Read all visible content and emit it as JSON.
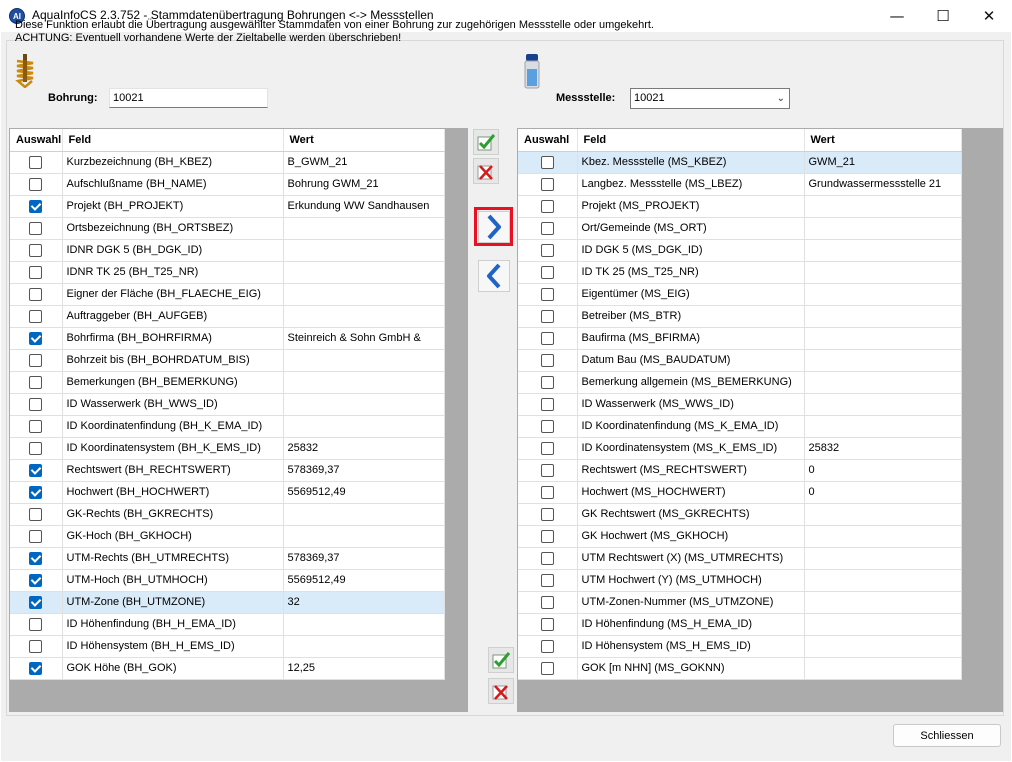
{
  "window": {
    "title": "AquaInfoCS 2.3.752 - Stammdatenübertragung Bohrungen <-> Messstellen",
    "app_icon_text": "AI",
    "minimize": "—",
    "maximize": "☐",
    "close": "✕"
  },
  "info": {
    "line1": "Diese Funktion erlaubt die Übertragung ausgewählter Stammdaten von einer Bohrung zur zugehörigen Messstelle oder umgekehrt.",
    "line2": "ACHTUNG: Eventuell vorhandene Werte der Zieltabelle werden überschrieben!"
  },
  "bohrung": {
    "label": "Bohrung:",
    "value": "10021"
  },
  "messstelle": {
    "label": "Messstelle:",
    "value": "10021"
  },
  "columns": {
    "select": "Auswahl",
    "field": "Feld",
    "value": "Wert"
  },
  "left_rows": [
    {
      "checked": false,
      "field": "Kurzbezeichnung (BH_KBEZ)",
      "value": "B_GWM_21"
    },
    {
      "checked": false,
      "field": "Aufschlußname (BH_NAME)",
      "value": "Bohrung GWM_21"
    },
    {
      "checked": true,
      "field": "Projekt (BH_PROJEKT)",
      "value": "Erkundung WW Sandhausen"
    },
    {
      "checked": false,
      "field": "Ortsbezeichnung (BH_ORTSBEZ)",
      "value": ""
    },
    {
      "checked": false,
      "field": "IDNR DGK 5 (BH_DGK_ID)",
      "value": ""
    },
    {
      "checked": false,
      "field": "IDNR TK 25 (BH_T25_NR)",
      "value": ""
    },
    {
      "checked": false,
      "field": "Eigner der Fläche (BH_FLAECHE_EIG)",
      "value": ""
    },
    {
      "checked": false,
      "field": "Auftraggeber (BH_AUFGEB)",
      "value": ""
    },
    {
      "checked": true,
      "field": "Bohrfirma (BH_BOHRFIRMA)",
      "value": "Steinreich & Sohn GmbH &"
    },
    {
      "checked": false,
      "field": "Bohrzeit bis (BH_BOHRDATUM_BIS)",
      "value": ""
    },
    {
      "checked": false,
      "field": "Bemerkungen (BH_BEMERKUNG)",
      "value": ""
    },
    {
      "checked": false,
      "field": "ID Wasserwerk (BH_WWS_ID)",
      "value": ""
    },
    {
      "checked": false,
      "field": "ID Koordinatenfindung (BH_K_EMA_ID)",
      "value": ""
    },
    {
      "checked": false,
      "field": "ID Koordinatensystem (BH_K_EMS_ID)",
      "value": "25832"
    },
    {
      "checked": true,
      "field": "Rechtswert (BH_RECHTSWERT)",
      "value": "578369,37"
    },
    {
      "checked": true,
      "field": "Hochwert (BH_HOCHWERT)",
      "value": "5569512,49"
    },
    {
      "checked": false,
      "field": "GK-Rechts (BH_GKRECHTS)",
      "value": ""
    },
    {
      "checked": false,
      "field": "GK-Hoch (BH_GKHOCH)",
      "value": ""
    },
    {
      "checked": true,
      "field": "UTM-Rechts (BH_UTMRECHTS)",
      "value": "578369,37"
    },
    {
      "checked": true,
      "field": "UTM-Hoch (BH_UTMHOCH)",
      "value": "5569512,49"
    },
    {
      "checked": true,
      "field": "UTM-Zone (BH_UTMZONE)",
      "value": "32",
      "selected": true
    },
    {
      "checked": false,
      "field": "ID Höhenfindung (BH_H_EMA_ID)",
      "value": ""
    },
    {
      "checked": false,
      "field": "ID Höhensystem (BH_H_EMS_ID)",
      "value": ""
    },
    {
      "checked": true,
      "field": "GOK Höhe (BH_GOK)",
      "value": "12,25"
    }
  ],
  "right_rows": [
    {
      "checked": false,
      "field": "Kbez. Messstelle (MS_KBEZ)",
      "value": "GWM_21",
      "selected": true
    },
    {
      "checked": false,
      "field": "Langbez. Messstelle (MS_LBEZ)",
      "value": "Grundwassermessstelle 21"
    },
    {
      "checked": false,
      "field": "Projekt (MS_PROJEKT)",
      "value": ""
    },
    {
      "checked": false,
      "field": "Ort/Gemeinde (MS_ORT)",
      "value": ""
    },
    {
      "checked": false,
      "field": "ID  DGK 5 (MS_DGK_ID)",
      "value": ""
    },
    {
      "checked": false,
      "field": "ID TK 25 (MS_T25_NR)",
      "value": ""
    },
    {
      "checked": false,
      "field": "Eigentümer (MS_EIG)",
      "value": ""
    },
    {
      "checked": false,
      "field": "Betreiber (MS_BTR)",
      "value": ""
    },
    {
      "checked": false,
      "field": "Baufirma (MS_BFIRMA)",
      "value": ""
    },
    {
      "checked": false,
      "field": "Datum Bau (MS_BAUDATUM)",
      "value": ""
    },
    {
      "checked": false,
      "field": "Bemerkung allgemein (MS_BEMERKUNG)",
      "value": ""
    },
    {
      "checked": false,
      "field": "ID Wasserwerk (MS_WWS_ID)",
      "value": ""
    },
    {
      "checked": false,
      "field": "ID Koordinatenfindung (MS_K_EMA_ID)",
      "value": ""
    },
    {
      "checked": false,
      "field": "ID Koordinatensystem (MS_K_EMS_ID)",
      "value": "25832"
    },
    {
      "checked": false,
      "field": "Rechtswert (MS_RECHTSWERT)",
      "value": "0"
    },
    {
      "checked": false,
      "field": "Hochwert (MS_HOCHWERT)",
      "value": "0"
    },
    {
      "checked": false,
      "field": "GK Rechtswert (MS_GKRECHTS)",
      "value": ""
    },
    {
      "checked": false,
      "field": "GK Hochwert (MS_GKHOCH)",
      "value": ""
    },
    {
      "checked": false,
      "field": "UTM Rechtswert (X) (MS_UTMRECHTS)",
      "value": ""
    },
    {
      "checked": false,
      "field": "UTM Hochwert (Y) (MS_UTMHOCH)",
      "value": ""
    },
    {
      "checked": false,
      "field": "UTM-Zonen-Nummer (MS_UTMZONE)",
      "value": ""
    },
    {
      "checked": false,
      "field": "ID Höhenfindung (MS_H_EMA_ID)",
      "value": ""
    },
    {
      "checked": false,
      "field": "ID Höhensystem (MS_H_EMS_ID)",
      "value": ""
    },
    {
      "checked": false,
      "field": "GOK [m NHN] (MS_GOKNN)",
      "value": ""
    }
  ],
  "buttons": {
    "close_label": "Schliessen",
    "select_all_icon": "check-all-icon",
    "deselect_all_icon": "uncheck-all-icon",
    "transfer_right_icon": "chevron-right-icon",
    "transfer_left_icon": "chevron-left-icon"
  },
  "colors": {
    "accent": "#0067c0",
    "selection": "#d9eaf9",
    "highlight_frame": "#e81123",
    "grid_background": "#ababab"
  }
}
